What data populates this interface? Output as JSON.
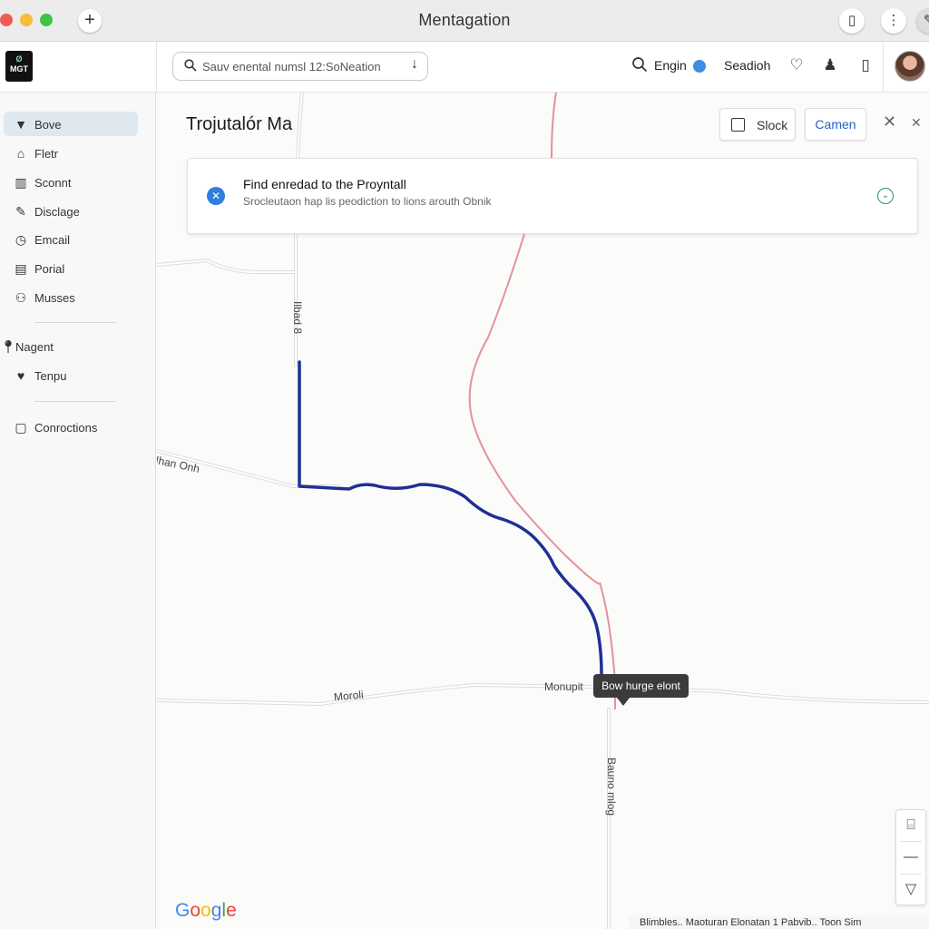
{
  "window": {
    "title": "Mentagation"
  },
  "appbar": {
    "logo_top": "Ø",
    "logo_bottom": "MGT",
    "search_text": "Sauv enental numsl 12:SoNeation",
    "engin_label": "Engin",
    "seadioh_label": "Seadioh",
    "icons": [
      "search-icon",
      "heart-icon",
      "person-icon",
      "battery-icon"
    ]
  },
  "sidebar": {
    "items": [
      {
        "label": "Bove",
        "icon": "pin-icon",
        "active": true
      },
      {
        "label": "Fletr",
        "icon": "home-icon"
      },
      {
        "label": "Sconnt",
        "icon": "grid-icon"
      },
      {
        "label": "Disclage",
        "icon": "pencil-icon"
      },
      {
        "label": "Emcail",
        "icon": "clock-icon"
      },
      {
        "label": "Porial",
        "icon": "folder-icon"
      },
      {
        "label": "Musses",
        "icon": "users-icon"
      }
    ],
    "secondary": [
      {
        "label": "Nagent",
        "icon": "location-icon"
      },
      {
        "label": "Tenpu",
        "icon": "heart-icon"
      }
    ],
    "tertiary": [
      {
        "label": "Conroctions",
        "icon": "square-icon"
      }
    ]
  },
  "map": {
    "title": "Trojutalór Ma",
    "slock_label": "Slock",
    "camen_label": "Camen",
    "banner": {
      "title": "Find enredad to the Proyntall",
      "subtitle": "Srocleutaon hap lis peodiction to lions arouth Obnik"
    },
    "road_labels": {
      "vertical_top": "Ilbad 8",
      "west": "Ihan Onh",
      "south_west": "Moroli",
      "junction": "Monupit",
      "vertical_bottom": "Bauno mlog"
    },
    "tooltip": "Bow hurge elont",
    "google": [
      "G",
      "o",
      "o",
      "g",
      "l",
      "e"
    ],
    "attribution": "Blimbles.. Maoturan   Elonatan 1 Pabvib..  Toon  Sim"
  },
  "colors": {
    "route": "#1f2f96",
    "alt_route": "#e27f8f",
    "accent": "#2f7fdc"
  }
}
